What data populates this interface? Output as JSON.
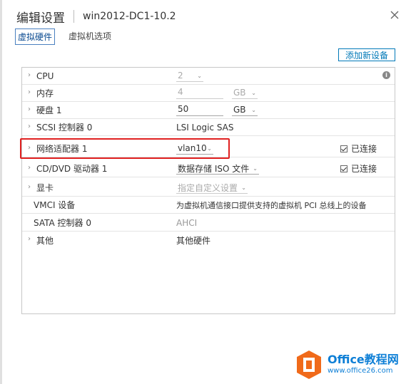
{
  "dialog": {
    "title": "编辑设置",
    "vm_name": "win2012-DC1-10.2"
  },
  "tabs": [
    {
      "label": "虚拟硬件",
      "active": true
    },
    {
      "label": "虚拟机选项",
      "active": false
    }
  ],
  "toolbar": {
    "add_device_label": "添加新设备"
  },
  "hardware": {
    "cpu": {
      "label": "CPU",
      "value": "2"
    },
    "memory": {
      "label": "内存",
      "value": "4",
      "unit": "GB"
    },
    "disk": {
      "label": "硬盘 1",
      "value": "50",
      "unit": "GB"
    },
    "scsi": {
      "label": "SCSI 控制器 0",
      "value": "LSI Logic SAS"
    },
    "network": {
      "label": "网络适配器 1",
      "value": "vlan10",
      "connected_label": "已连接"
    },
    "cdrom": {
      "label": "CD/DVD 驱动器 1",
      "value": "数据存储 ISO 文件",
      "connected_label": "已连接"
    },
    "video": {
      "label": "显卡",
      "value": "指定自定义设置"
    },
    "vmci": {
      "label": "VMCI 设备",
      "value": "为虚拟机通信接口提供支持的虚拟机 PCI 总线上的设备"
    },
    "sata": {
      "label": "SATA 控制器 0",
      "value": "AHCI"
    },
    "other": {
      "label": "其他",
      "value": "其他硬件"
    }
  },
  "watermark": {
    "brand": "Office教程网",
    "url": "www.office26.com"
  },
  "colors": {
    "accent": "#0079b8",
    "highlight": "#e02020",
    "logo_orange": "#f06a1a",
    "logo_blue": "#0e7fd6"
  }
}
